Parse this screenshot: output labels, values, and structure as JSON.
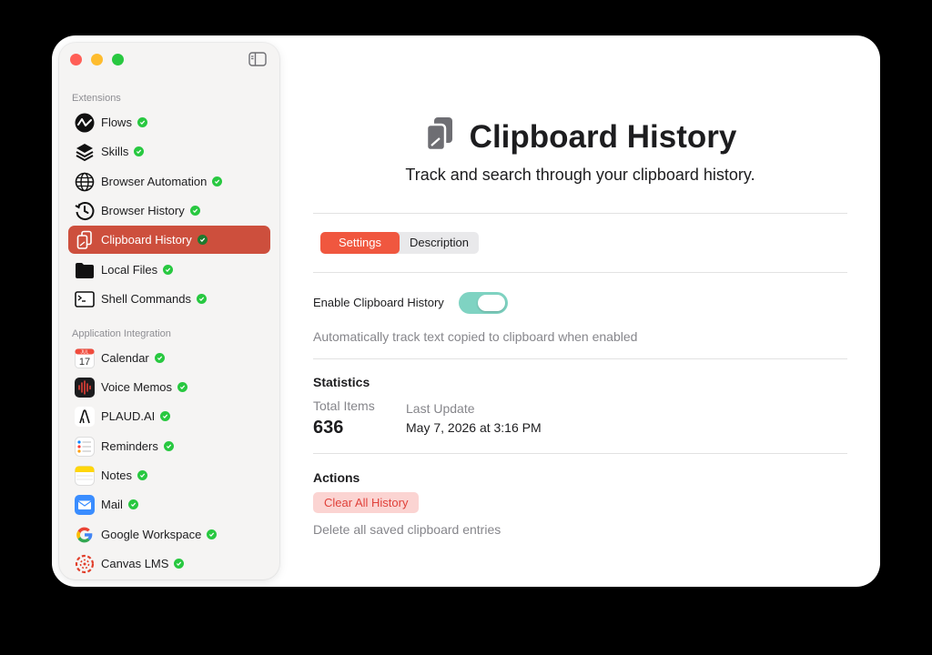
{
  "sidebar": {
    "section_extensions": "Extensions",
    "section_integration": "Application Integration",
    "extensions": [
      {
        "label": "Flows",
        "icon": "flows-icon"
      },
      {
        "label": "Skills",
        "icon": "skills-icon"
      },
      {
        "label": "Browser Automation",
        "icon": "globe-icon"
      },
      {
        "label": "Browser History",
        "icon": "history-icon"
      },
      {
        "label": "Clipboard History",
        "icon": "clipboard-icon",
        "active": true
      },
      {
        "label": "Local Files",
        "icon": "folder-icon"
      },
      {
        "label": "Shell Commands",
        "icon": "terminal-icon"
      }
    ],
    "integrations": [
      {
        "label": "Calendar",
        "icon": "calendar-icon",
        "calendar_month": "JUL",
        "calendar_day": "17"
      },
      {
        "label": "Voice Memos",
        "icon": "voice-memos-icon"
      },
      {
        "label": "PLAUD.AI",
        "icon": "plaud-icon"
      },
      {
        "label": "Reminders",
        "icon": "reminders-icon"
      },
      {
        "label": "Notes",
        "icon": "notes-icon"
      },
      {
        "label": "Mail",
        "icon": "mail-icon"
      },
      {
        "label": "Google Workspace",
        "icon": "google-icon"
      },
      {
        "label": "Canvas LMS",
        "icon": "canvas-icon"
      }
    ]
  },
  "main": {
    "title": "Clipboard History",
    "subtitle": "Track and search through your clipboard history.",
    "tabs": [
      {
        "label": "Settings",
        "active": true
      },
      {
        "label": "Description",
        "active": false
      }
    ],
    "enable_label": "Enable Clipboard History",
    "enable_on": true,
    "enable_help": "Automatically track text copied to clipboard when enabled",
    "statistics_title": "Statistics",
    "total_items_label": "Total Items",
    "total_items_value": "636",
    "last_update_label": "Last Update",
    "last_update_value": "May 7, 2026 at 3:16 PM",
    "actions_title": "Actions",
    "clear_button": "Clear All History",
    "clear_help": "Delete all saved clipboard entries"
  },
  "colors": {
    "accent": "#cd4f3d",
    "tab_active": "#f0573f",
    "toggle_on": "#7fd3c2",
    "check_green": "#28c840",
    "danger_text": "#e0413a",
    "danger_bg": "#fbd4d2"
  }
}
